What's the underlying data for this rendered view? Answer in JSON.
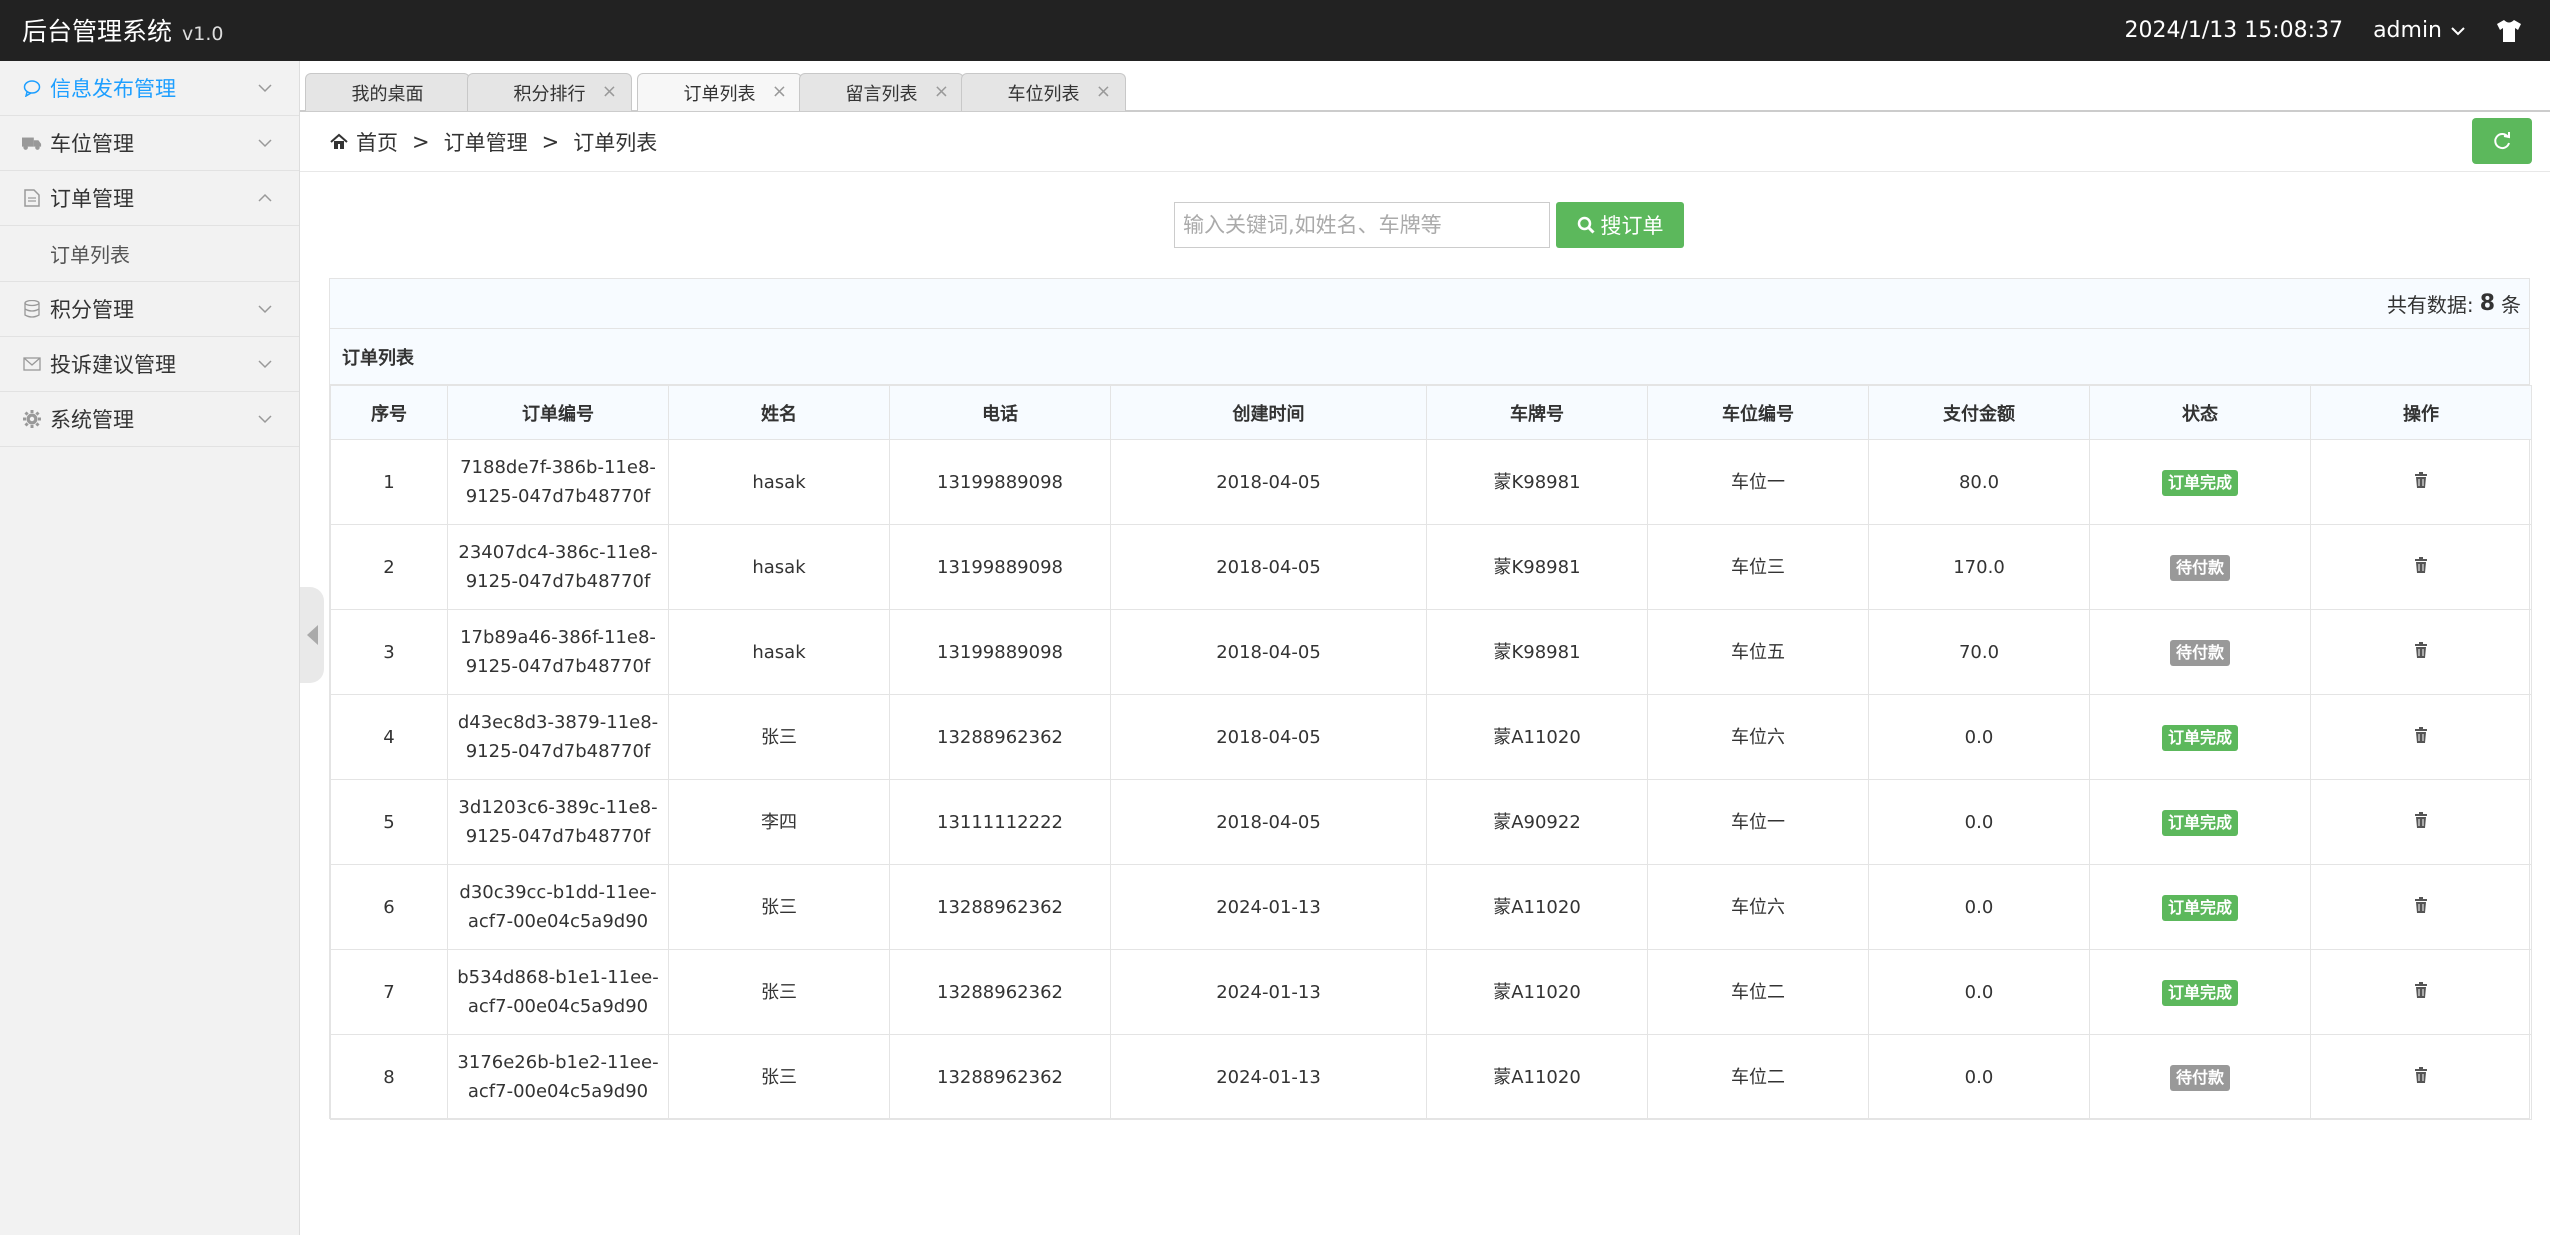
{
  "app": {
    "title": "后台管理系统",
    "version": "v1.0"
  },
  "header": {
    "datetime": "2024/1/13 15:08:37",
    "user": "admin"
  },
  "sidebar": {
    "items": [
      {
        "label": "信息发布管理"
      },
      {
        "label": "车位管理"
      },
      {
        "label": "订单管理"
      },
      {
        "label": "订单列表"
      },
      {
        "label": "积分管理"
      },
      {
        "label": "投诉建议管理"
      },
      {
        "label": "系统管理"
      }
    ]
  },
  "tabs": [
    {
      "label": "我的桌面"
    },
    {
      "label": "积分排行"
    },
    {
      "label": "订单列表"
    },
    {
      "label": "留言列表"
    },
    {
      "label": "车位列表"
    }
  ],
  "breadcrumb": {
    "home": "首页",
    "level1": "订单管理",
    "level2": "订单列表",
    "sep": ">"
  },
  "search": {
    "placeholder": "输入关键词,如姓名、车牌等",
    "button": "搜订单"
  },
  "summary": {
    "prefix": "共有数据:",
    "count": "8",
    "suffix": "条"
  },
  "table": {
    "title": "订单列表",
    "columns": [
      "序号",
      "订单编号",
      "姓名",
      "电话",
      "创建时间",
      "车牌号",
      "车位编号",
      "支付金额",
      "状态",
      "操作"
    ],
    "rows": [
      {
        "no": "1",
        "id1": "7188de7f-386b-11e8-",
        "id2": "9125-047d7b48770f",
        "name": "hasak",
        "phone": "13199889098",
        "date": "2018-04-05",
        "plate": "蒙K98981",
        "space": "车位一",
        "amount": "80.0",
        "status": "订单完成",
        "status_type": "done"
      },
      {
        "no": "2",
        "id1": "23407dc4-386c-11e8-",
        "id2": "9125-047d7b48770f",
        "name": "hasak",
        "phone": "13199889098",
        "date": "2018-04-05",
        "plate": "蒙K98981",
        "space": "车位三",
        "amount": "170.0",
        "status": "待付款",
        "status_type": "pending"
      },
      {
        "no": "3",
        "id1": "17b89a46-386f-11e8-",
        "id2": "9125-047d7b48770f",
        "name": "hasak",
        "phone": "13199889098",
        "date": "2018-04-05",
        "plate": "蒙K98981",
        "space": "车位五",
        "amount": "70.0",
        "status": "待付款",
        "status_type": "pending"
      },
      {
        "no": "4",
        "id1": "d43ec8d3-3879-11e8-",
        "id2": "9125-047d7b48770f",
        "name": "张三",
        "phone": "13288962362",
        "date": "2018-04-05",
        "plate": "蒙A11020",
        "space": "车位六",
        "amount": "0.0",
        "status": "订单完成",
        "status_type": "done"
      },
      {
        "no": "5",
        "id1": "3d1203c6-389c-11e8-",
        "id2": "9125-047d7b48770f",
        "name": "李四",
        "phone": "13111112222",
        "date": "2018-04-05",
        "plate": "蒙A90922",
        "space": "车位一",
        "amount": "0.0",
        "status": "订单完成",
        "status_type": "done"
      },
      {
        "no": "6",
        "id1": "d30c39cc-b1dd-11ee-",
        "id2": "acf7-00e04c5a9d90",
        "name": "张三",
        "phone": "13288962362",
        "date": "2024-01-13",
        "plate": "蒙A11020",
        "space": "车位六",
        "amount": "0.0",
        "status": "订单完成",
        "status_type": "done"
      },
      {
        "no": "7",
        "id1": "b534d868-b1e1-11ee-",
        "id2": "acf7-00e04c5a9d90",
        "name": "张三",
        "phone": "13288962362",
        "date": "2024-01-13",
        "plate": "蒙A11020",
        "space": "车位二",
        "amount": "0.0",
        "status": "订单完成",
        "status_type": "done"
      },
      {
        "no": "8",
        "id1": "3176e26b-b1e2-11ee-",
        "id2": "acf7-00e04c5a9d90",
        "name": "张三",
        "phone": "13288962362",
        "date": "2024-01-13",
        "plate": "蒙A11020",
        "space": "车位二",
        "amount": "0.0",
        "status": "待付款",
        "status_type": "pending"
      }
    ]
  },
  "colors": {
    "accent": "#1e9fff",
    "success": "#5cb85c",
    "muted": "#999999",
    "topbar": "#222222"
  }
}
